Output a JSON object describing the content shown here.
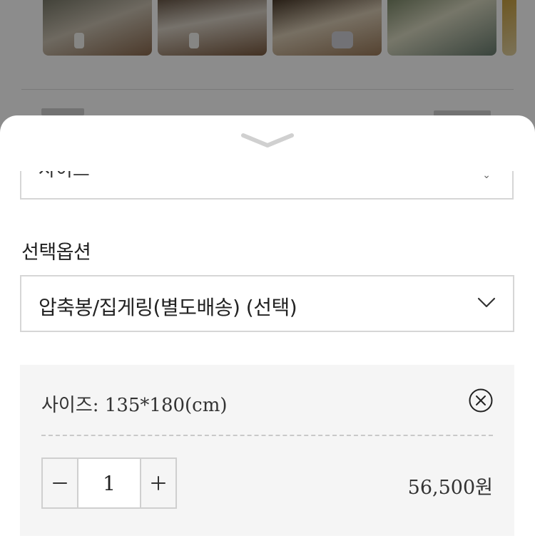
{
  "option_sheet": {
    "partial_field_text": "사이즈",
    "section_label": "선택옵션",
    "option_select_value": "압축봉/집게링(별도배송) (선택)"
  },
  "selected_item": {
    "name": "사이즈: 135*180(cm)",
    "quantity": "1",
    "price": "56,500원",
    "minus_symbol": "−",
    "plus_symbol": "+"
  },
  "icons": {
    "collapse": "chevron-down-icon",
    "select": "chevron-down-icon",
    "remove": "close-circle-icon"
  },
  "colors": {
    "border": "#d6d6d6",
    "selected_bg": "#f5f5f5",
    "text": "#222222"
  }
}
